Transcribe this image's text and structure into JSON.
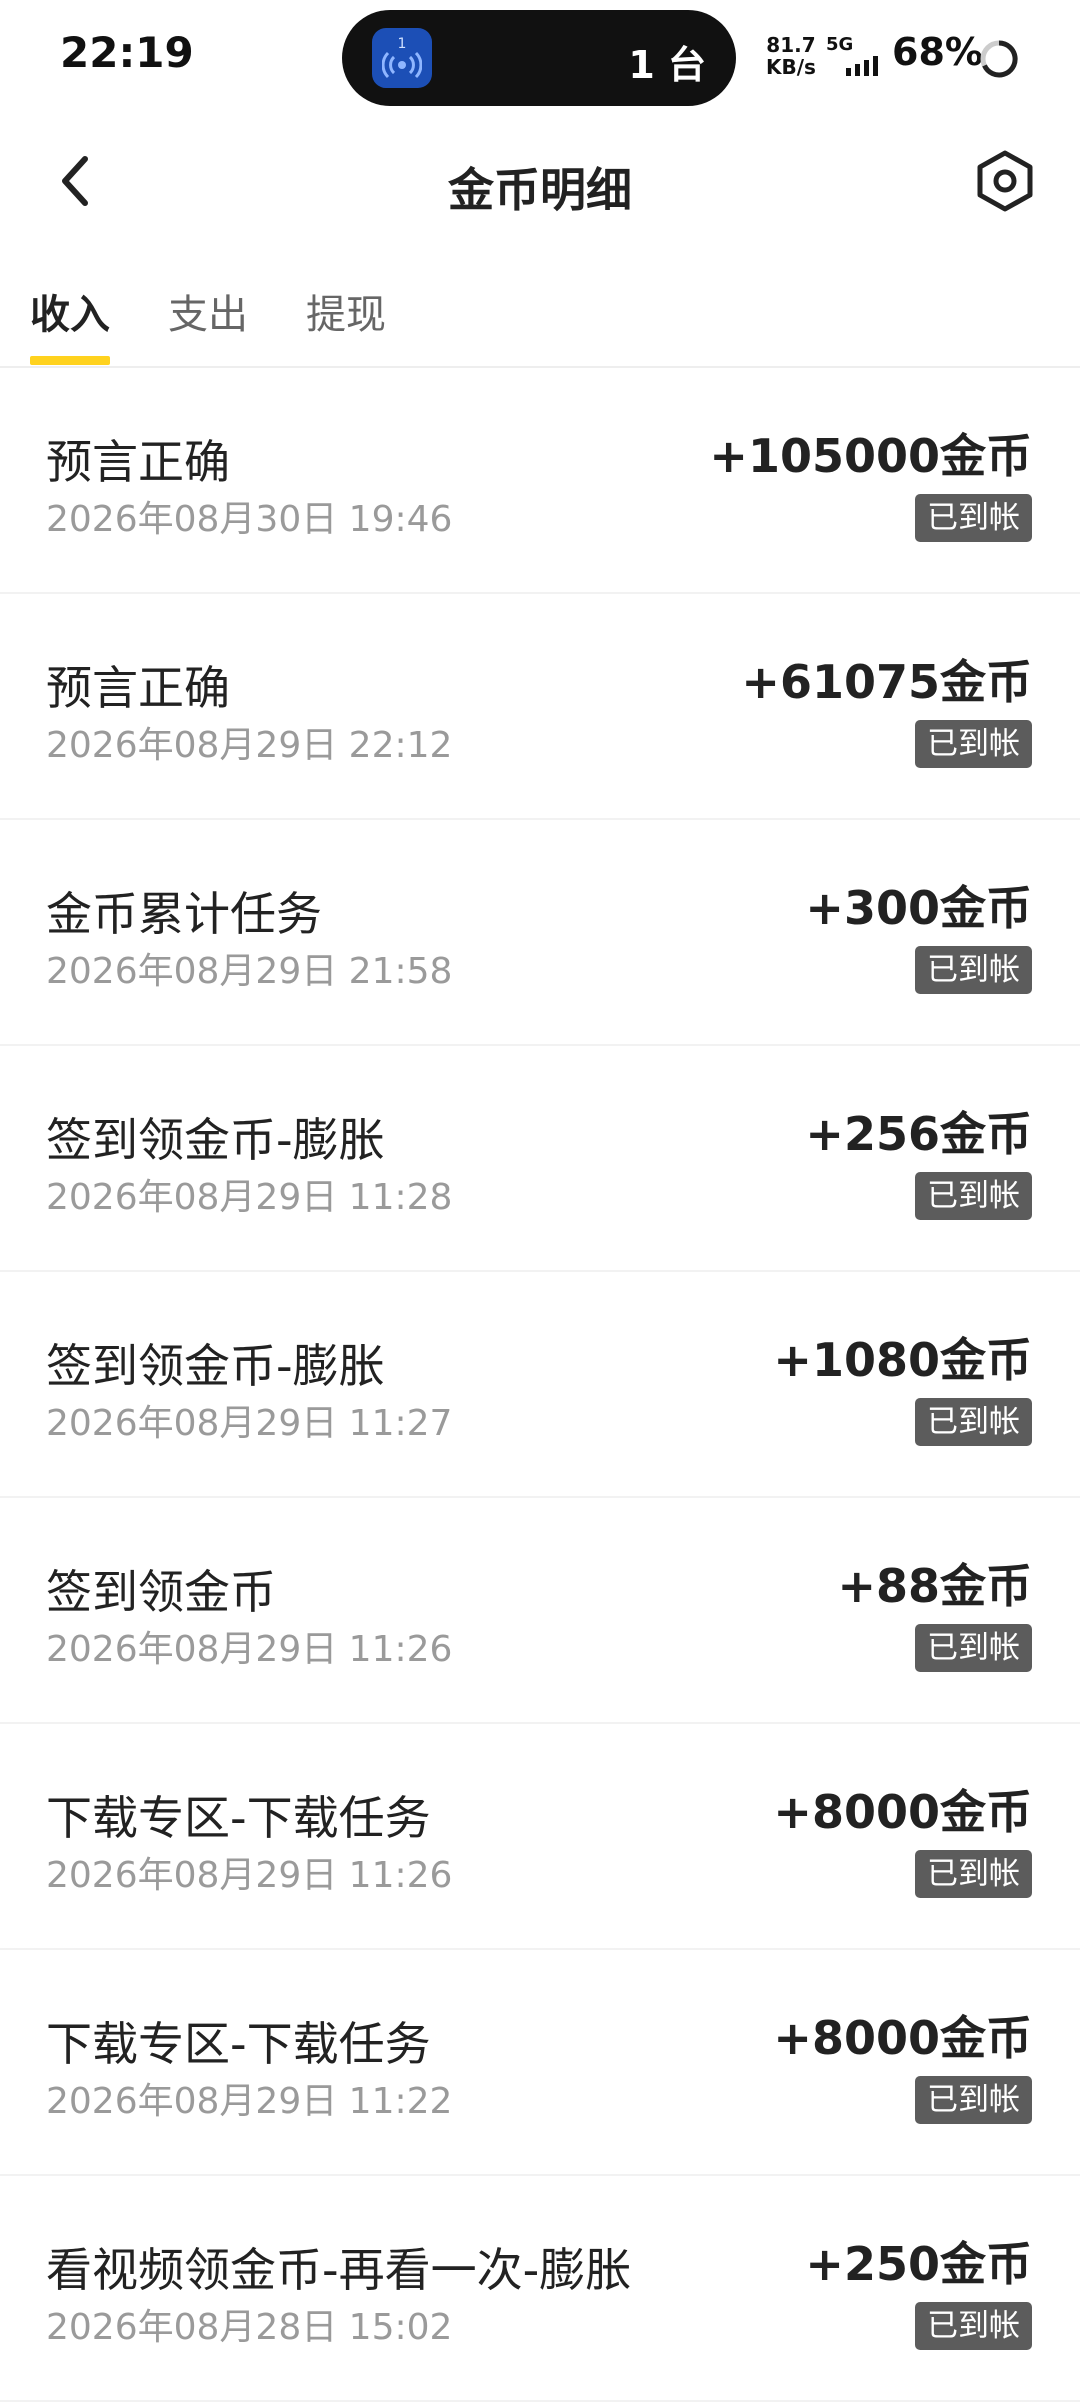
{
  "status_bar": {
    "time": "22:19",
    "island_count": "1 台",
    "island_app_badge": "1",
    "net_speed_value": "81.7",
    "net_speed_unit": "KB/s",
    "network": "5G",
    "battery": "68%"
  },
  "nav": {
    "title": "金币明细",
    "back_icon": "chevron-left-icon",
    "settings_icon": "hexagon-settings-icon"
  },
  "tabs": [
    {
      "label": "收入",
      "active": true
    },
    {
      "label": "支出",
      "active": false
    },
    {
      "label": "提现",
      "active": false
    }
  ],
  "colors": {
    "tab_indicator": "#ffd21e",
    "badge_bg": "#5c5c5c",
    "date_text": "#9a9a9a"
  },
  "records": [
    {
      "title": "预言正确",
      "date": "2026年08月30日 19:46",
      "amount": "+105000金币",
      "status": "已到帐"
    },
    {
      "title": "预言正确",
      "date": "2026年08月29日 22:12",
      "amount": "+61075金币",
      "status": "已到帐"
    },
    {
      "title": "金币累计任务",
      "date": "2026年08月29日 21:58",
      "amount": "+300金币",
      "status": "已到帐"
    },
    {
      "title": "签到领金币-膨胀",
      "date": "2026年08月29日 11:28",
      "amount": "+256金币",
      "status": "已到帐"
    },
    {
      "title": "签到领金币-膨胀",
      "date": "2026年08月29日 11:27",
      "amount": "+1080金币",
      "status": "已到帐"
    },
    {
      "title": "签到领金币",
      "date": "2026年08月29日 11:26",
      "amount": "+88金币",
      "status": "已到帐"
    },
    {
      "title": "下载专区-下载任务",
      "date": "2026年08月29日 11:26",
      "amount": "+8000金币",
      "status": "已到帐"
    },
    {
      "title": "下载专区-下载任务",
      "date": "2026年08月29日 11:22",
      "amount": "+8000金币",
      "status": "已到帐"
    },
    {
      "title": "看视频领金币-再看一次-膨胀",
      "date": "2026年08月28日 15:02",
      "amount": "+250金币",
      "status": "已到帐"
    }
  ]
}
